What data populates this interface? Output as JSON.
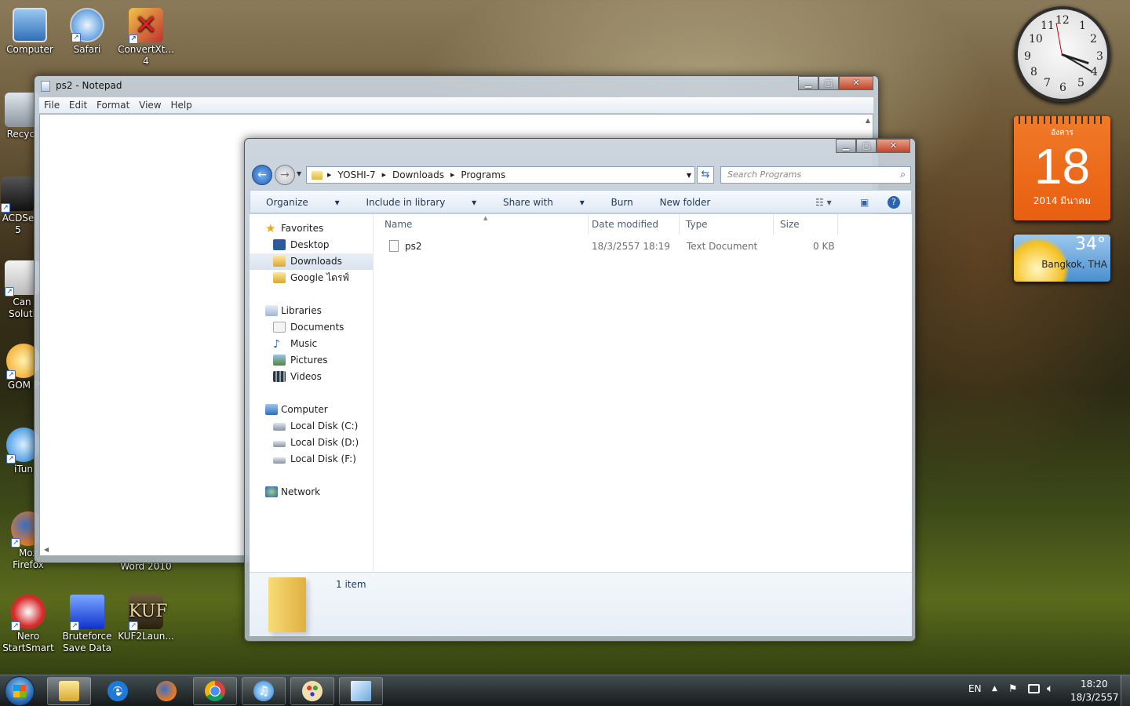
{
  "desktop_icons": [
    {
      "label": "Computer"
    },
    {
      "label": "Safari"
    },
    {
      "label": "ConvertXt...",
      "sub": "4"
    },
    {
      "label": "Recycl"
    },
    {
      "label": "ACDSe",
      "sub": "5"
    },
    {
      "label": "Can",
      "sub": "Soluti"
    },
    {
      "label": "GOM P"
    },
    {
      "label": "iTun"
    },
    {
      "label": "Moz",
      "sub": "Firefox"
    },
    {
      "label": "Nero",
      "sub": "StartSmart"
    },
    {
      "label": "Bruteforce",
      "sub": "Save Data"
    },
    {
      "label": "KUF2Laun..."
    },
    {
      "label": "Word 2010"
    }
  ],
  "clock": {
    "numbers": [
      "12",
      "1",
      "2",
      "3",
      "4",
      "5",
      "6",
      "7",
      "8",
      "9",
      "10",
      "11"
    ]
  },
  "calendar": {
    "weekday": "อังคาร",
    "day": "18",
    "month_year": "2014 มีนาคม"
  },
  "weather": {
    "temp": "34°",
    "city": "Bangkok, THA"
  },
  "notepad": {
    "title": "ps2 - Notepad",
    "menu": [
      "File",
      "Edit",
      "Format",
      "View",
      "Help"
    ]
  },
  "explorer": {
    "address": {
      "parts": [
        "YOSHI-7",
        "Downloads",
        "Programs"
      ]
    },
    "search_placeholder": "Search Programs",
    "toolbar": {
      "organize": "Organize",
      "include": "Include in library",
      "share": "Share with",
      "burn": "Burn",
      "new_folder": "New folder"
    },
    "nav": {
      "favorites": "Favorites",
      "desktop": "Desktop",
      "downloads": "Downloads",
      "google": "Google ไดรฟ์",
      "libraries": "Libraries",
      "documents": "Documents",
      "music": "Music",
      "pictures": "Pictures",
      "videos": "Videos",
      "computer": "Computer",
      "disk_c": "Local Disk (C:)",
      "disk_d": "Local Disk (D:)",
      "disk_f": "Local Disk (F:)",
      "network": "Network"
    },
    "columns": {
      "name": "Name",
      "date": "Date modified",
      "type": "Type",
      "size": "Size"
    },
    "files": [
      {
        "name": "ps2",
        "date": "18/3/2557 18:19",
        "type": "Text Document",
        "size": "0 KB"
      }
    ],
    "status": "1 item"
  },
  "tray": {
    "lang": "EN",
    "time": "18:20",
    "date": "18/3/2557"
  },
  "colors": {
    "accent": "#3a6ec8",
    "calendar": "#ea6a18"
  }
}
